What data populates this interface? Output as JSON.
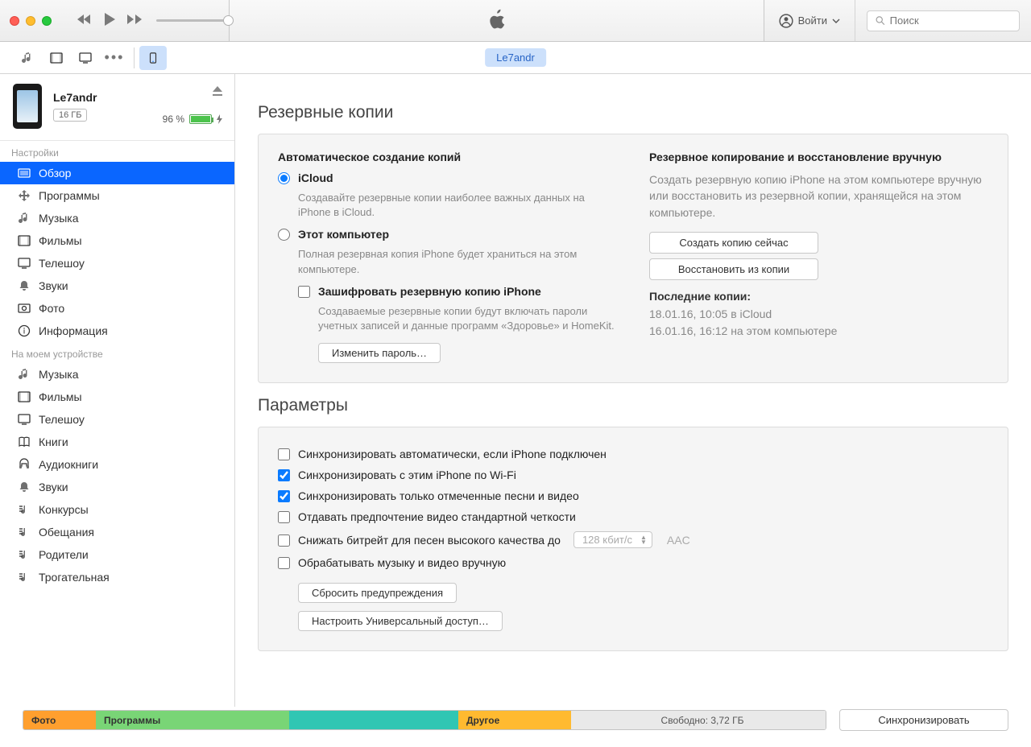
{
  "titlebar": {
    "account_label": "Войти",
    "search_placeholder": "Поиск"
  },
  "toolbar2": {
    "device_pill": "Le7andr"
  },
  "device": {
    "name": "Le7andr",
    "capacity": "16 ГБ",
    "battery_pct": "96 %"
  },
  "sidebar": {
    "group1_label": "Настройки",
    "settings_items": [
      {
        "label": "Обзор",
        "icon": "overview",
        "selected": true
      },
      {
        "label": "Программы",
        "icon": "apps"
      },
      {
        "label": "Музыка",
        "icon": "music"
      },
      {
        "label": "Фильмы",
        "icon": "movies"
      },
      {
        "label": "Телешоу",
        "icon": "tv"
      },
      {
        "label": "Звуки",
        "icon": "bell"
      },
      {
        "label": "Фото",
        "icon": "photo"
      },
      {
        "label": "Информация",
        "icon": "info"
      }
    ],
    "group2_label": "На моем устройстве",
    "device_items": [
      {
        "label": "Музыка",
        "icon": "music"
      },
      {
        "label": "Фильмы",
        "icon": "movies"
      },
      {
        "label": "Телешоу",
        "icon": "tv"
      },
      {
        "label": "Книги",
        "icon": "books"
      },
      {
        "label": "Аудиокниги",
        "icon": "audiobooks"
      },
      {
        "label": "Звуки",
        "icon": "bell"
      },
      {
        "label": "Конкурсы",
        "icon": "playlist"
      },
      {
        "label": "Обещания",
        "icon": "playlist"
      },
      {
        "label": "Родители",
        "icon": "playlist"
      },
      {
        "label": "Трогательная",
        "icon": "playlist"
      }
    ]
  },
  "backups": {
    "section_title": "Резервные копии",
    "auto_title": "Автоматическое создание копий",
    "icloud_label": "iCloud",
    "icloud_desc": "Создавайте резервные копии наиболее важных данных на iPhone в iCloud.",
    "thispc_label": "Этот компьютер",
    "thispc_desc": "Полная резервная копия iPhone будет храниться на этом компьютере.",
    "encrypt_label": "Зашифровать резервную копию iPhone",
    "encrypt_desc": "Создаваемые резервные копии будут включать пароли учетных записей и данные программ «Здоровье» и HomeKit.",
    "change_pw_btn": "Изменить пароль…",
    "manual_title": "Резервное копирование и восстановление вручную",
    "manual_desc": "Создать резервную копию iPhone на этом компьютере вручную или восстановить из резервной копии, хранящейся на этом компьютере.",
    "backup_now_btn": "Создать копию сейчас",
    "restore_btn": "Восстановить из копии",
    "latest_label": "Последние копии:",
    "latest_1": "18.01.16, 10:05 в iCloud",
    "latest_2": "16.01.16, 16:12 на этом компьютере"
  },
  "options": {
    "section_title": "Параметры",
    "opt_autosync": "Синхронизировать автоматически, если iPhone подключен",
    "opt_wifi": "Синхронизировать с этим iPhone по Wi-Fi",
    "opt_checked_only": "Синхронизировать только отмеченные песни и видео",
    "opt_sd_video": "Отдавать предпочтение видео стандартной четкости",
    "opt_bitrate": "Снижать битрейт для песен высокого качества до",
    "bitrate_value": "128 кбит/с",
    "aac": "AAC",
    "opt_manual": "Обрабатывать музыку и видео вручную",
    "reset_warnings_btn": "Сбросить предупреждения",
    "accessibility_btn": "Настроить Универсальный доступ…"
  },
  "footer": {
    "photo": "Фото",
    "apps": "Программы",
    "other": "Другое",
    "free": "Свободно: 3,72 ГБ",
    "sync_btn": "Синхронизировать"
  }
}
